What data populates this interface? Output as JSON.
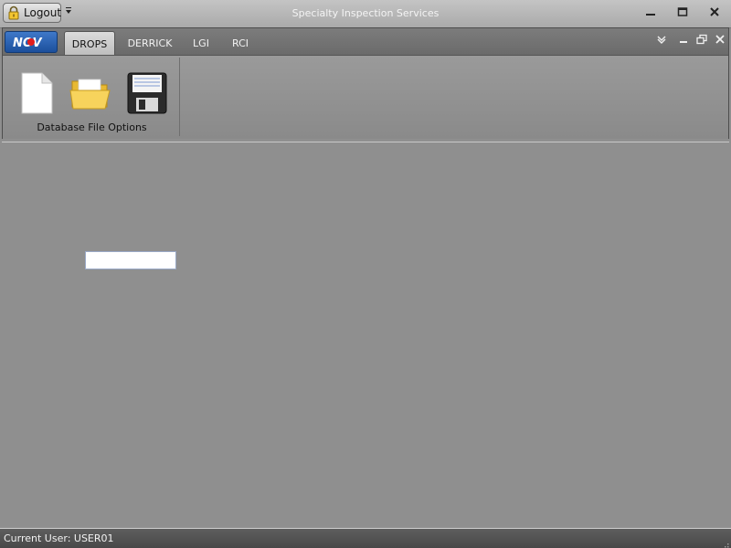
{
  "titlebar": {
    "logout_label": "Logout",
    "title": "Specialty Inspection Services",
    "minimize_icon": "minimize-icon",
    "restore_icon": "restore-icon",
    "close_icon": "close-icon"
  },
  "ribbon": {
    "app_menu_logo": "NOV",
    "tabs": [
      {
        "label": "DROPS",
        "active": true
      },
      {
        "label": "DERRICK",
        "active": false
      },
      {
        "label": "LGI",
        "active": false
      },
      {
        "label": "RCI",
        "active": false
      }
    ],
    "groups": [
      {
        "label": "Database File Options",
        "buttons": [
          {
            "name": "new-file",
            "icon": "document-icon"
          },
          {
            "name": "open-file",
            "icon": "folder-icon"
          },
          {
            "name": "save-file",
            "icon": "floppy-disk-icon"
          }
        ]
      }
    ]
  },
  "workspace": {
    "input_value": ""
  },
  "statusbar": {
    "current_user": "Current User: USER01"
  },
  "colors": {
    "ribbon_dark": "#6e6e6e",
    "workspace_bg": "#8f8f8f",
    "app_button_blue": "#2a5fae",
    "status_bar": "#4f4f4f"
  }
}
